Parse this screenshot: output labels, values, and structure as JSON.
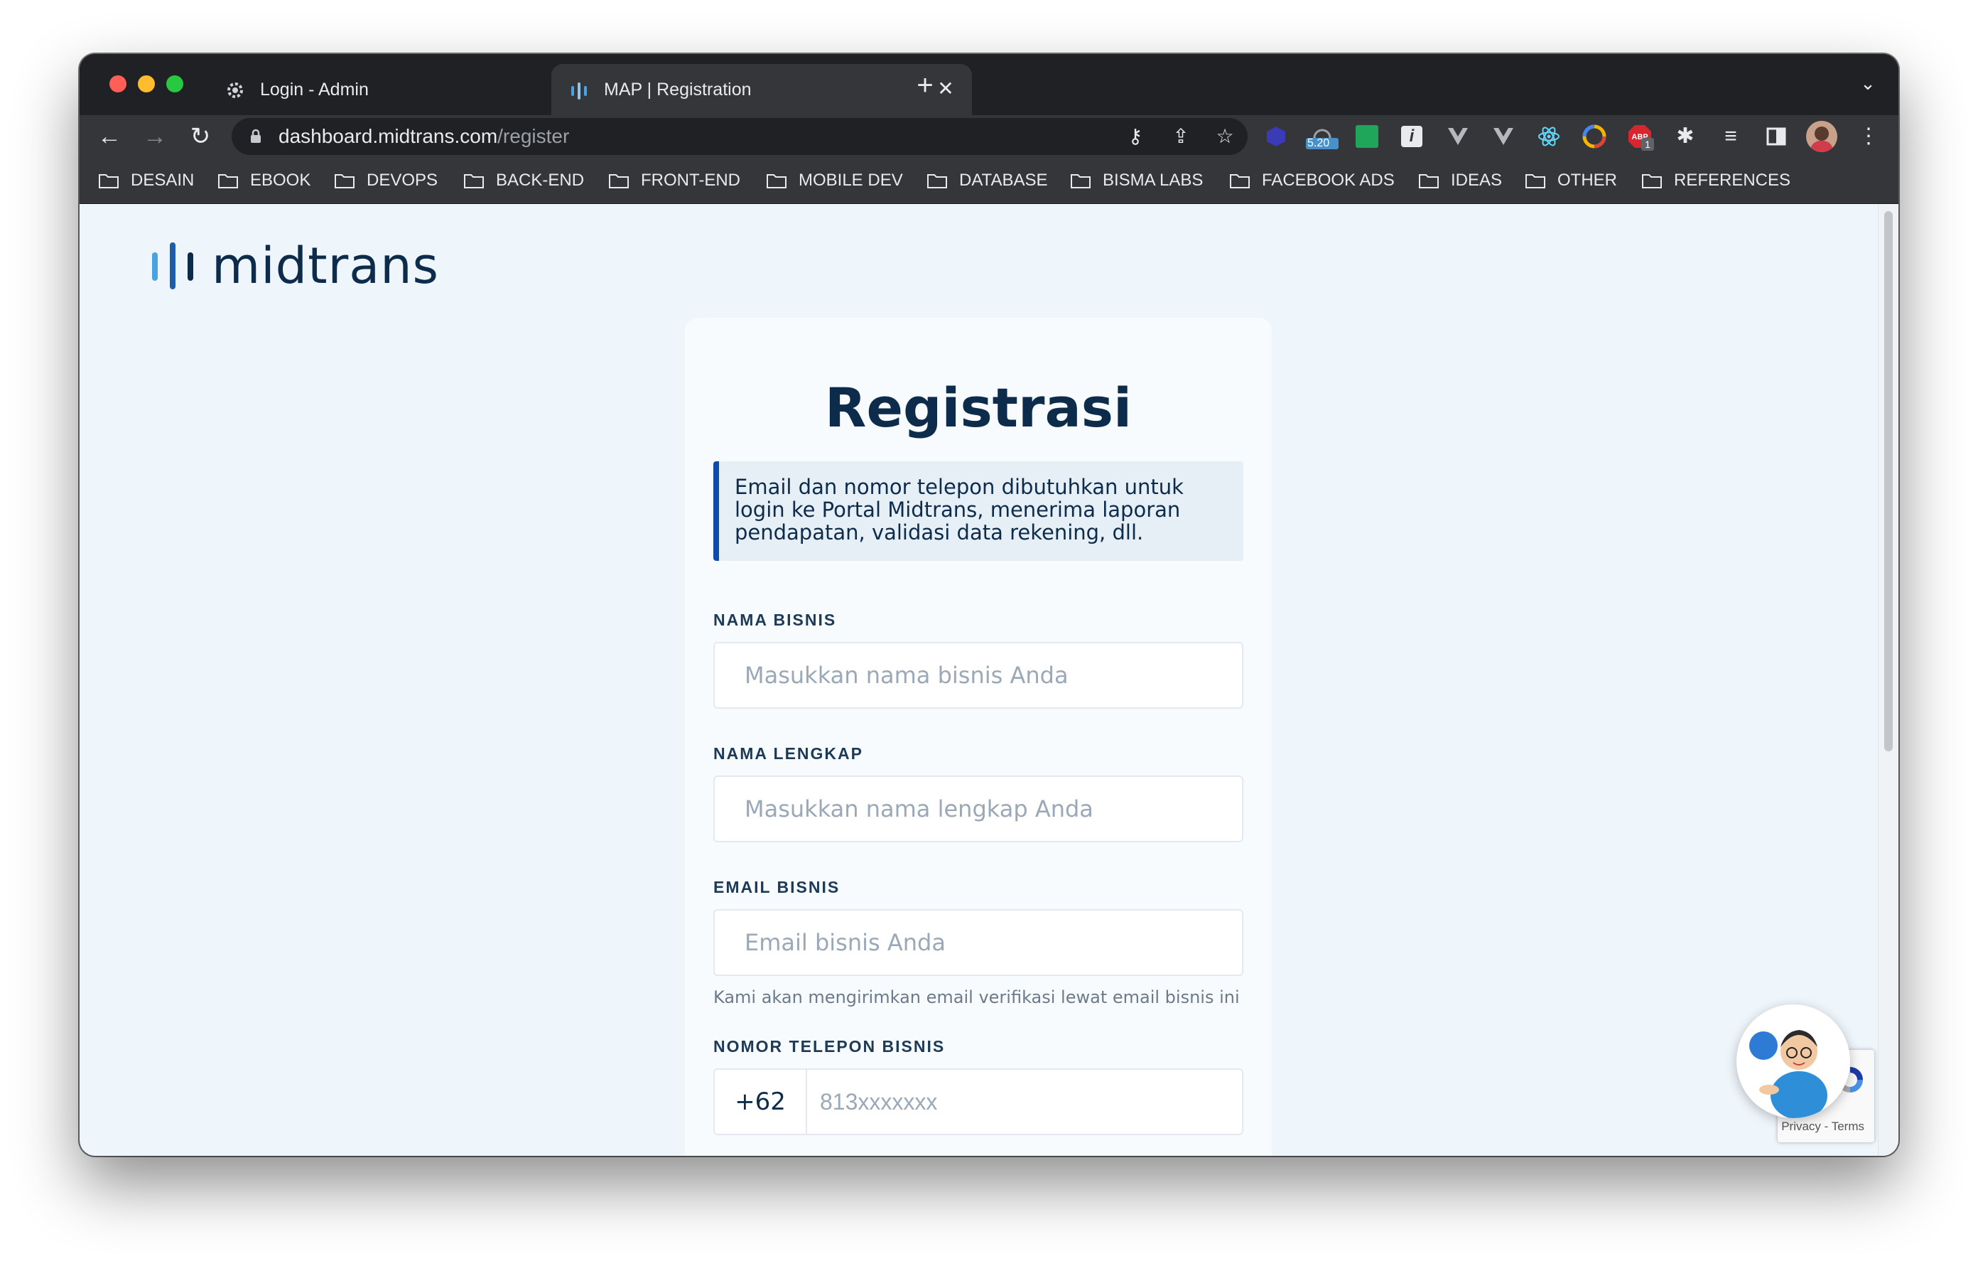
{
  "browser": {
    "tabs": [
      {
        "title": "Login - Admin",
        "active": false,
        "icon": "gear-favicon-icon"
      },
      {
        "title": "MAP | Registration",
        "active": true,
        "icon": "midtrans-favicon-icon"
      }
    ],
    "url": {
      "host": "dashboard.midtrans.com",
      "path": "/register"
    },
    "extension_badge": "5.20",
    "abp_count": "1",
    "bookmarks": [
      "DESAIN",
      "EBOOK",
      "DEVOPS",
      "BACK-END",
      "FRONT-END",
      "MOBILE DEV",
      "DATABASE",
      "BISMA LABS",
      "FACEBOOK ADS",
      "IDEAS",
      "OTHER",
      "REFERENCES"
    ]
  },
  "page": {
    "logo": "midtrans",
    "title": "Registrasi",
    "info": "Email dan nomor telepon dibutuhkan untuk login ke Portal Midtrans, menerima laporan pendapatan, validasi data rekening, dll.",
    "fields": {
      "business_name": {
        "label": "NAMA BISNIS",
        "placeholder": "Masukkan nama bisnis Anda"
      },
      "full_name": {
        "label": "NAMA LENGKAP",
        "placeholder": "Masukkan nama lengkap Anda"
      },
      "business_email": {
        "label": "EMAIL BISNIS",
        "placeholder": "Email bisnis Anda",
        "helper": "Kami akan mengirimkan email verifikasi lewat email bisnis ini"
      },
      "phone": {
        "label": "NOMOR TELEPON BISNIS",
        "prefix": "+62",
        "placeholder": "813xxxxxxx"
      }
    },
    "recaptcha": "Privacy - Terms"
  },
  "colors": {
    "brand_dark": "#0d2b4b",
    "brand_blue": "#0e4ca7",
    "page_bg": "#eef5fb"
  }
}
